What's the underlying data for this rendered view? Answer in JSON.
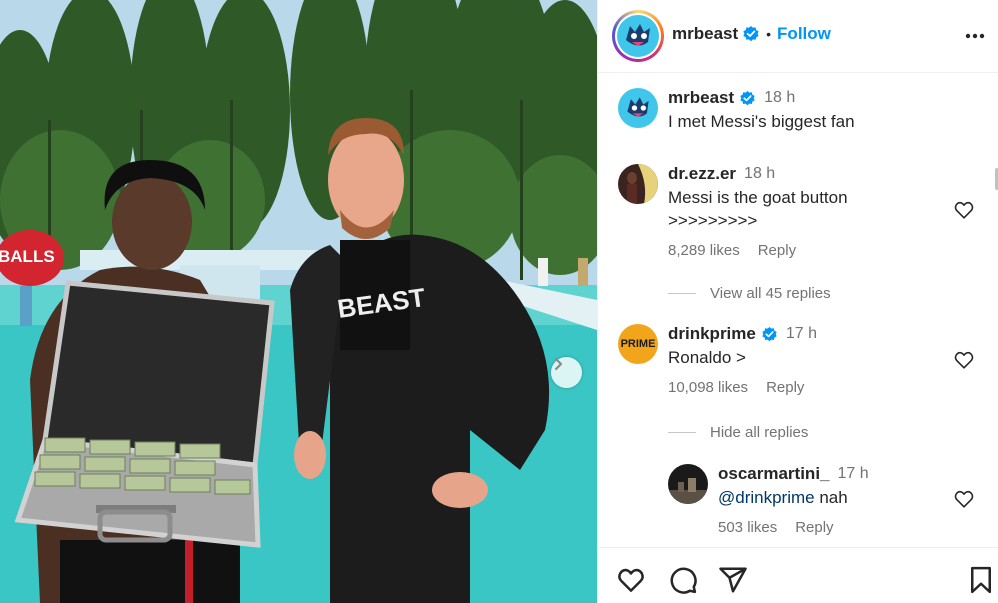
{
  "post": {
    "username": "mrbeast",
    "follow_label": "Follow",
    "separator": "•",
    "caption": "I met Messi's biggest fan",
    "caption_time": "18 h",
    "money_ball_text": "BALLS",
    "shirt_text": "BEAST"
  },
  "comments": [
    {
      "username": "dr.ezz.er",
      "time": "18 h",
      "text_line1": "Messi is the goat button",
      "text_line2": ">>>>>>>>>",
      "likes": "8,289 likes",
      "reply_label": "Reply",
      "replies_toggle": "View all 45 replies"
    },
    {
      "username": "drinkprime",
      "avatar_text": "PRIME",
      "time": "17 h",
      "text": "Ronaldo >",
      "likes": "10,098 likes",
      "reply_label": "Reply",
      "replies_toggle": "Hide all replies"
    }
  ],
  "reply": {
    "username": "oscarmartini_",
    "time": "17 h",
    "mention": "@drinkprime",
    "text": " nah",
    "likes": "503 likes",
    "reply_label": "Reply"
  },
  "icons": {
    "verified": "verified-badge-icon",
    "more": "more-options-icon",
    "heart": "heart-icon",
    "comment": "comment-icon",
    "share": "share-icon",
    "save": "bookmark-icon",
    "next": "chevron-right-icon"
  },
  "colors": {
    "accent": "#0095f6",
    "verified": "#0095f6",
    "muted": "#737373",
    "mrbeast_avatar": "#3fc6ea",
    "prime_avatar": "#f2a51b"
  }
}
